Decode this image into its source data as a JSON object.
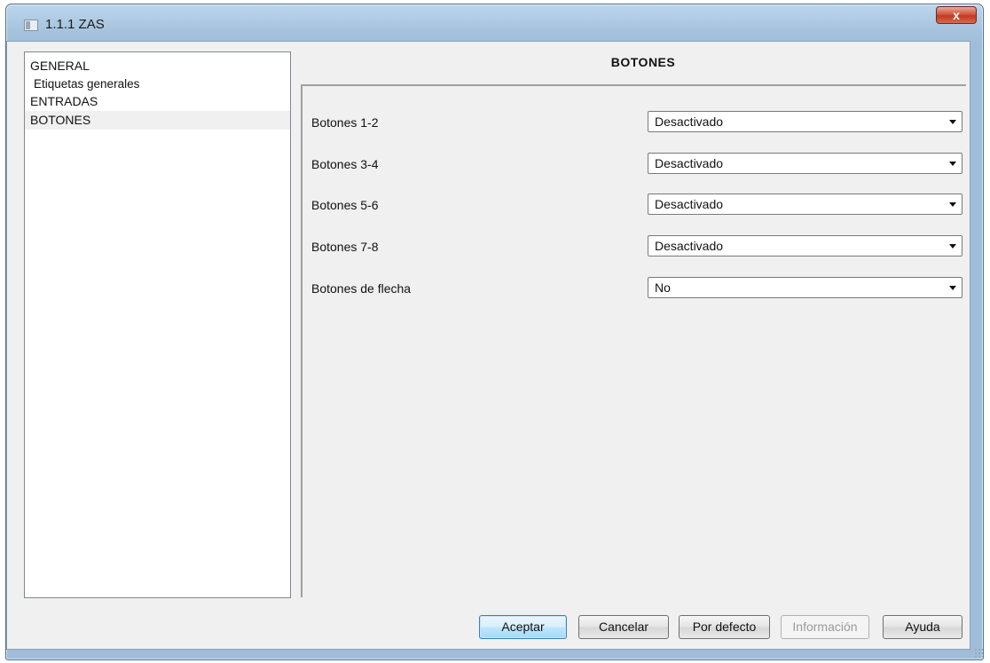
{
  "window": {
    "title": "1.1.1 ZAS",
    "close_glyph": "x"
  },
  "tree": {
    "items": [
      {
        "label": "GENERAL",
        "level": 0,
        "selected": false
      },
      {
        "label": "Etiquetas generales",
        "level": 1,
        "selected": false
      },
      {
        "label": "ENTRADAS",
        "level": 0,
        "selected": false
      },
      {
        "label": "BOTONES",
        "level": 0,
        "selected": true
      }
    ]
  },
  "section": {
    "title": "BOTONES"
  },
  "settings": [
    {
      "label": "Botones 1-2",
      "value": "Desactivado"
    },
    {
      "label": "Botones 3-4",
      "value": "Desactivado"
    },
    {
      "label": "Botones 5-6",
      "value": "Desactivado"
    },
    {
      "label": "Botones 7-8",
      "value": "Desactivado"
    },
    {
      "label": "Botones de flecha",
      "value": "No"
    }
  ],
  "buttons": {
    "accept": "Aceptar",
    "cancel": "Cancelar",
    "defaults": "Por defecto",
    "info": "Información",
    "help": "Ayuda"
  },
  "colors": {
    "titlebar": "#a6c3dd",
    "close_button": "#c23a22",
    "default_button_border": "#3c7fb1"
  }
}
